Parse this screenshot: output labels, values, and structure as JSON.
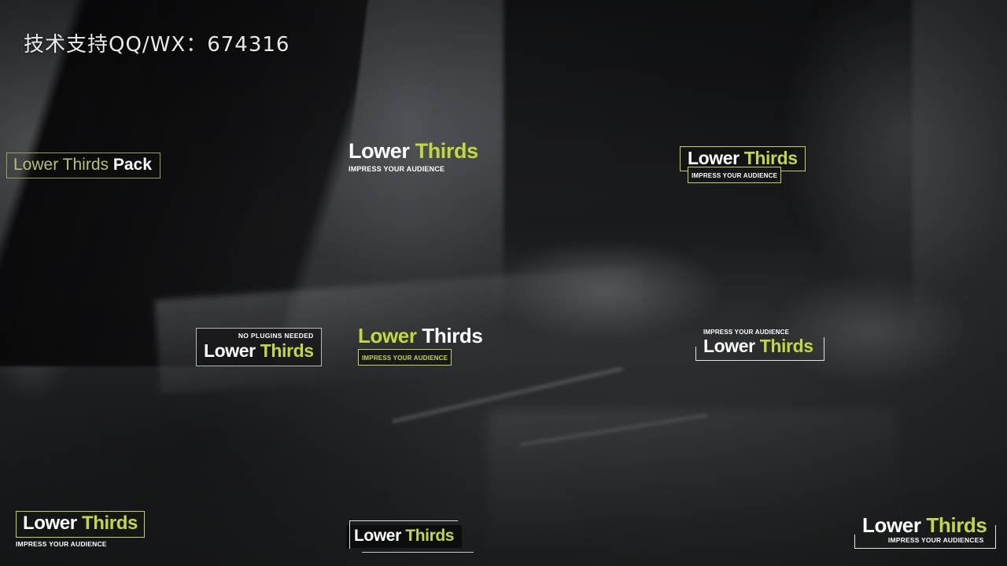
{
  "watermark": {
    "text": "技术支持QQ/WX：674316"
  },
  "brand": {
    "title_first": "Lower",
    "title_second": "Thirds",
    "accent_color": "#c3d83e",
    "white_color": "#ffffff",
    "dark_color": "#0c0d0e"
  },
  "lower_thirds": [
    {
      "id": "pack",
      "position": "top-left",
      "style": "outline-box-thin",
      "text_thin": "Lower Thirds ",
      "text_bold": "Pack",
      "border_color": "#9aa05c"
    },
    {
      "id": "center-top",
      "position": "top-center",
      "style": "plain",
      "title_first": "Lower",
      "title_second": "Thirds",
      "subtitle": "IMPRESS YOUR AUDIENCE"
    },
    {
      "id": "right-top",
      "position": "top-right",
      "style": "green-outline-box",
      "title_first": "Lower",
      "title_second": "Thirds",
      "subtitle": "IMPRESS YOUR AUDIENCE",
      "border_color": "#c3d83e"
    },
    {
      "id": "mid-left",
      "position": "middle-left",
      "style": "grey-outline-box-kicker",
      "kicker": "NO PLUGINS NEEDED",
      "title_first": "Lower",
      "title_second": "Thirds",
      "border_color": "#b6b9bc"
    },
    {
      "id": "mid-center",
      "position": "middle-center",
      "style": "inverted-accent",
      "title_first": "Lower",
      "title_second": "Thirds",
      "subtitle": "IMPRESS YOUR AUDIENCE"
    },
    {
      "id": "mid-right",
      "position": "middle-right",
      "style": "bracket-frame-sub-above",
      "subtitle": "IMPRESS YOUR AUDIENCE",
      "title_first": "Lower",
      "title_second": "Thirds"
    },
    {
      "id": "bottom-left",
      "position": "bottom-left",
      "style": "green-box-sub-below",
      "title_first": "Lower",
      "title_second": "Thirds",
      "subtitle": "IMPRESS YOUR AUDIENCE",
      "border_color": "#c3d83e"
    },
    {
      "id": "bottom-center",
      "position": "bottom-center",
      "style": "solid-bar-hairlines",
      "title_first": "Lower",
      "title_second": "Thirds"
    },
    {
      "id": "bottom-right",
      "position": "bottom-right",
      "style": "bracket-frame-sub-below",
      "title_first": "Lower",
      "title_second": "Thirds",
      "subtitle": "IMPRESS YOUR AUDIENCES"
    }
  ]
}
